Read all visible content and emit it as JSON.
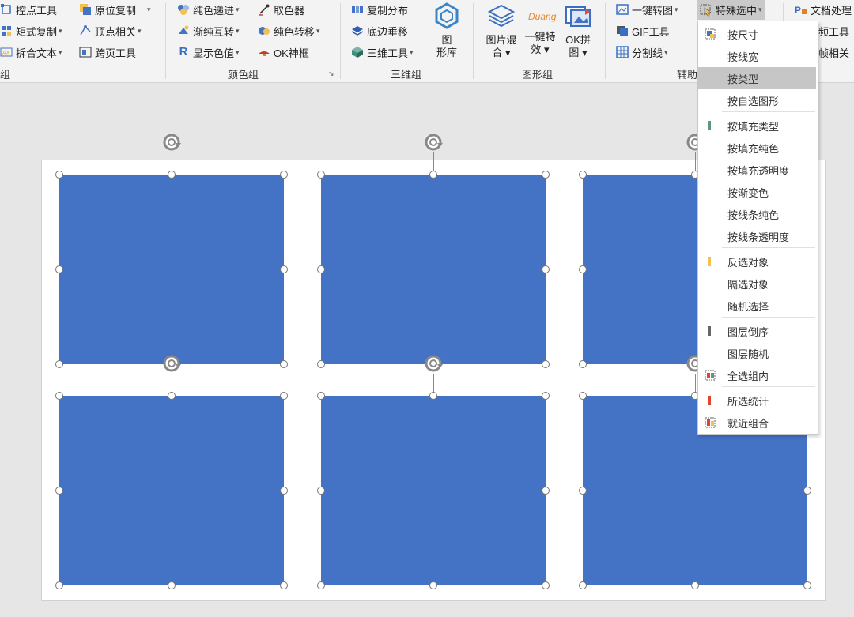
{
  "ribbon": {
    "groups": {
      "left": {
        "label": "组",
        "items": [
          {
            "label": "控点工具",
            "icon": "control-point-icon"
          },
          {
            "label": "原位复制",
            "icon": "copy-in-place-icon",
            "has_dropdown": true
          },
          {
            "label": "矩式复制",
            "icon": "matrix-copy-icon",
            "has_dropdown": true
          },
          {
            "label": "顶点相关",
            "icon": "vertex-icon",
            "has_dropdown": true
          },
          {
            "label": "拆合文本",
            "icon": "split-text-icon",
            "has_dropdown": true
          },
          {
            "label": "跨页工具",
            "icon": "cross-page-icon"
          }
        ]
      },
      "color": {
        "label": "颜色组",
        "items": [
          {
            "label": "纯色递进",
            "icon": "color-progress-icon",
            "has_dropdown": true
          },
          {
            "label": "取色器",
            "icon": "eyedropper-icon"
          },
          {
            "label": "渐纯互转",
            "icon": "gradient-swap-icon",
            "has_dropdown": true
          },
          {
            "label": "纯色转移",
            "icon": "color-transfer-icon",
            "has_dropdown": true
          },
          {
            "label": "显示色值",
            "icon": "r-letter-icon",
            "has_dropdown": true
          },
          {
            "label": "OK神框",
            "icon": "lamp-icon"
          }
        ]
      },
      "three_d": {
        "label": "三维组",
        "items": [
          {
            "label": "复制分布",
            "icon": "copy-distribute-icon"
          },
          {
            "label": "底边垂移",
            "icon": "layers-icon"
          },
          {
            "label": "三维工具",
            "icon": "cube-icon",
            "has_dropdown": true
          }
        ],
        "big": {
          "label_line1": "图",
          "label_line2": "形库",
          "icon": "hexagon-icon"
        }
      },
      "graphic": {
        "label": "图形组",
        "big_items": [
          {
            "line1": "图片混",
            "line2": "合",
            "icon": "image-blend-icon"
          },
          {
            "line1": "一键特",
            "line2": "效",
            "icon": "duang-icon",
            "icon_text": "Duang"
          },
          {
            "line1": "OK拼",
            "line2": "图",
            "icon": "ok-collage-icon"
          }
        ]
      },
      "assist": {
        "label": "辅助",
        "items": [
          {
            "label": "一键转图",
            "icon": "to-image-icon",
            "has_dropdown": true
          },
          {
            "label": "特殊选中",
            "icon": "special-select-icon",
            "has_dropdown": true
          },
          {
            "label": "GIF工具",
            "icon": "gif-icon"
          },
          {
            "label": "分割线",
            "icon": "grid-split-icon",
            "has_dropdown": true
          }
        ]
      },
      "doc": {
        "items": [
          {
            "label": "文档处理",
            "icon": "doc-process-icon"
          },
          {
            "label": "音频工具",
            "icon": "audio-icon"
          },
          {
            "label": "逐帧相关",
            "icon": "frame-icon"
          }
        ]
      }
    }
  },
  "menu": {
    "items": [
      {
        "label": "按尺寸",
        "icon": "size-select-icon"
      },
      {
        "label": "按线宽"
      },
      {
        "label": "按类型",
        "selected": true
      },
      {
        "label": "按自选图形"
      },
      {
        "label": "按填充类型",
        "icon": "fill-type-icon",
        "color": "#5a9a7a"
      },
      {
        "label": "按填充纯色"
      },
      {
        "label": "按填充透明度"
      },
      {
        "label": "按渐变色"
      },
      {
        "label": "按线条纯色"
      },
      {
        "label": "按线条透明度"
      },
      {
        "label": "反选对象",
        "icon": "invert-select-icon",
        "color": "#f2c14e"
      },
      {
        "label": "隔选对象"
      },
      {
        "label": "随机选择"
      },
      {
        "label": "图层倒序",
        "icon": "layer-reverse-icon",
        "color": "#666666"
      },
      {
        "label": "图层随机"
      },
      {
        "label": "全选组内",
        "icon": "select-group-icon"
      },
      {
        "label": "所选统计",
        "icon": "stats-icon",
        "color": "#e0442c"
      },
      {
        "label": "就近组合",
        "icon": "nearby-group-icon"
      }
    ]
  },
  "canvas": {
    "shape_color": "#4472c4",
    "shapes": [
      "rectangle",
      "rectangle",
      "rectangle",
      "rectangle",
      "rectangle",
      "rectangle"
    ]
  }
}
